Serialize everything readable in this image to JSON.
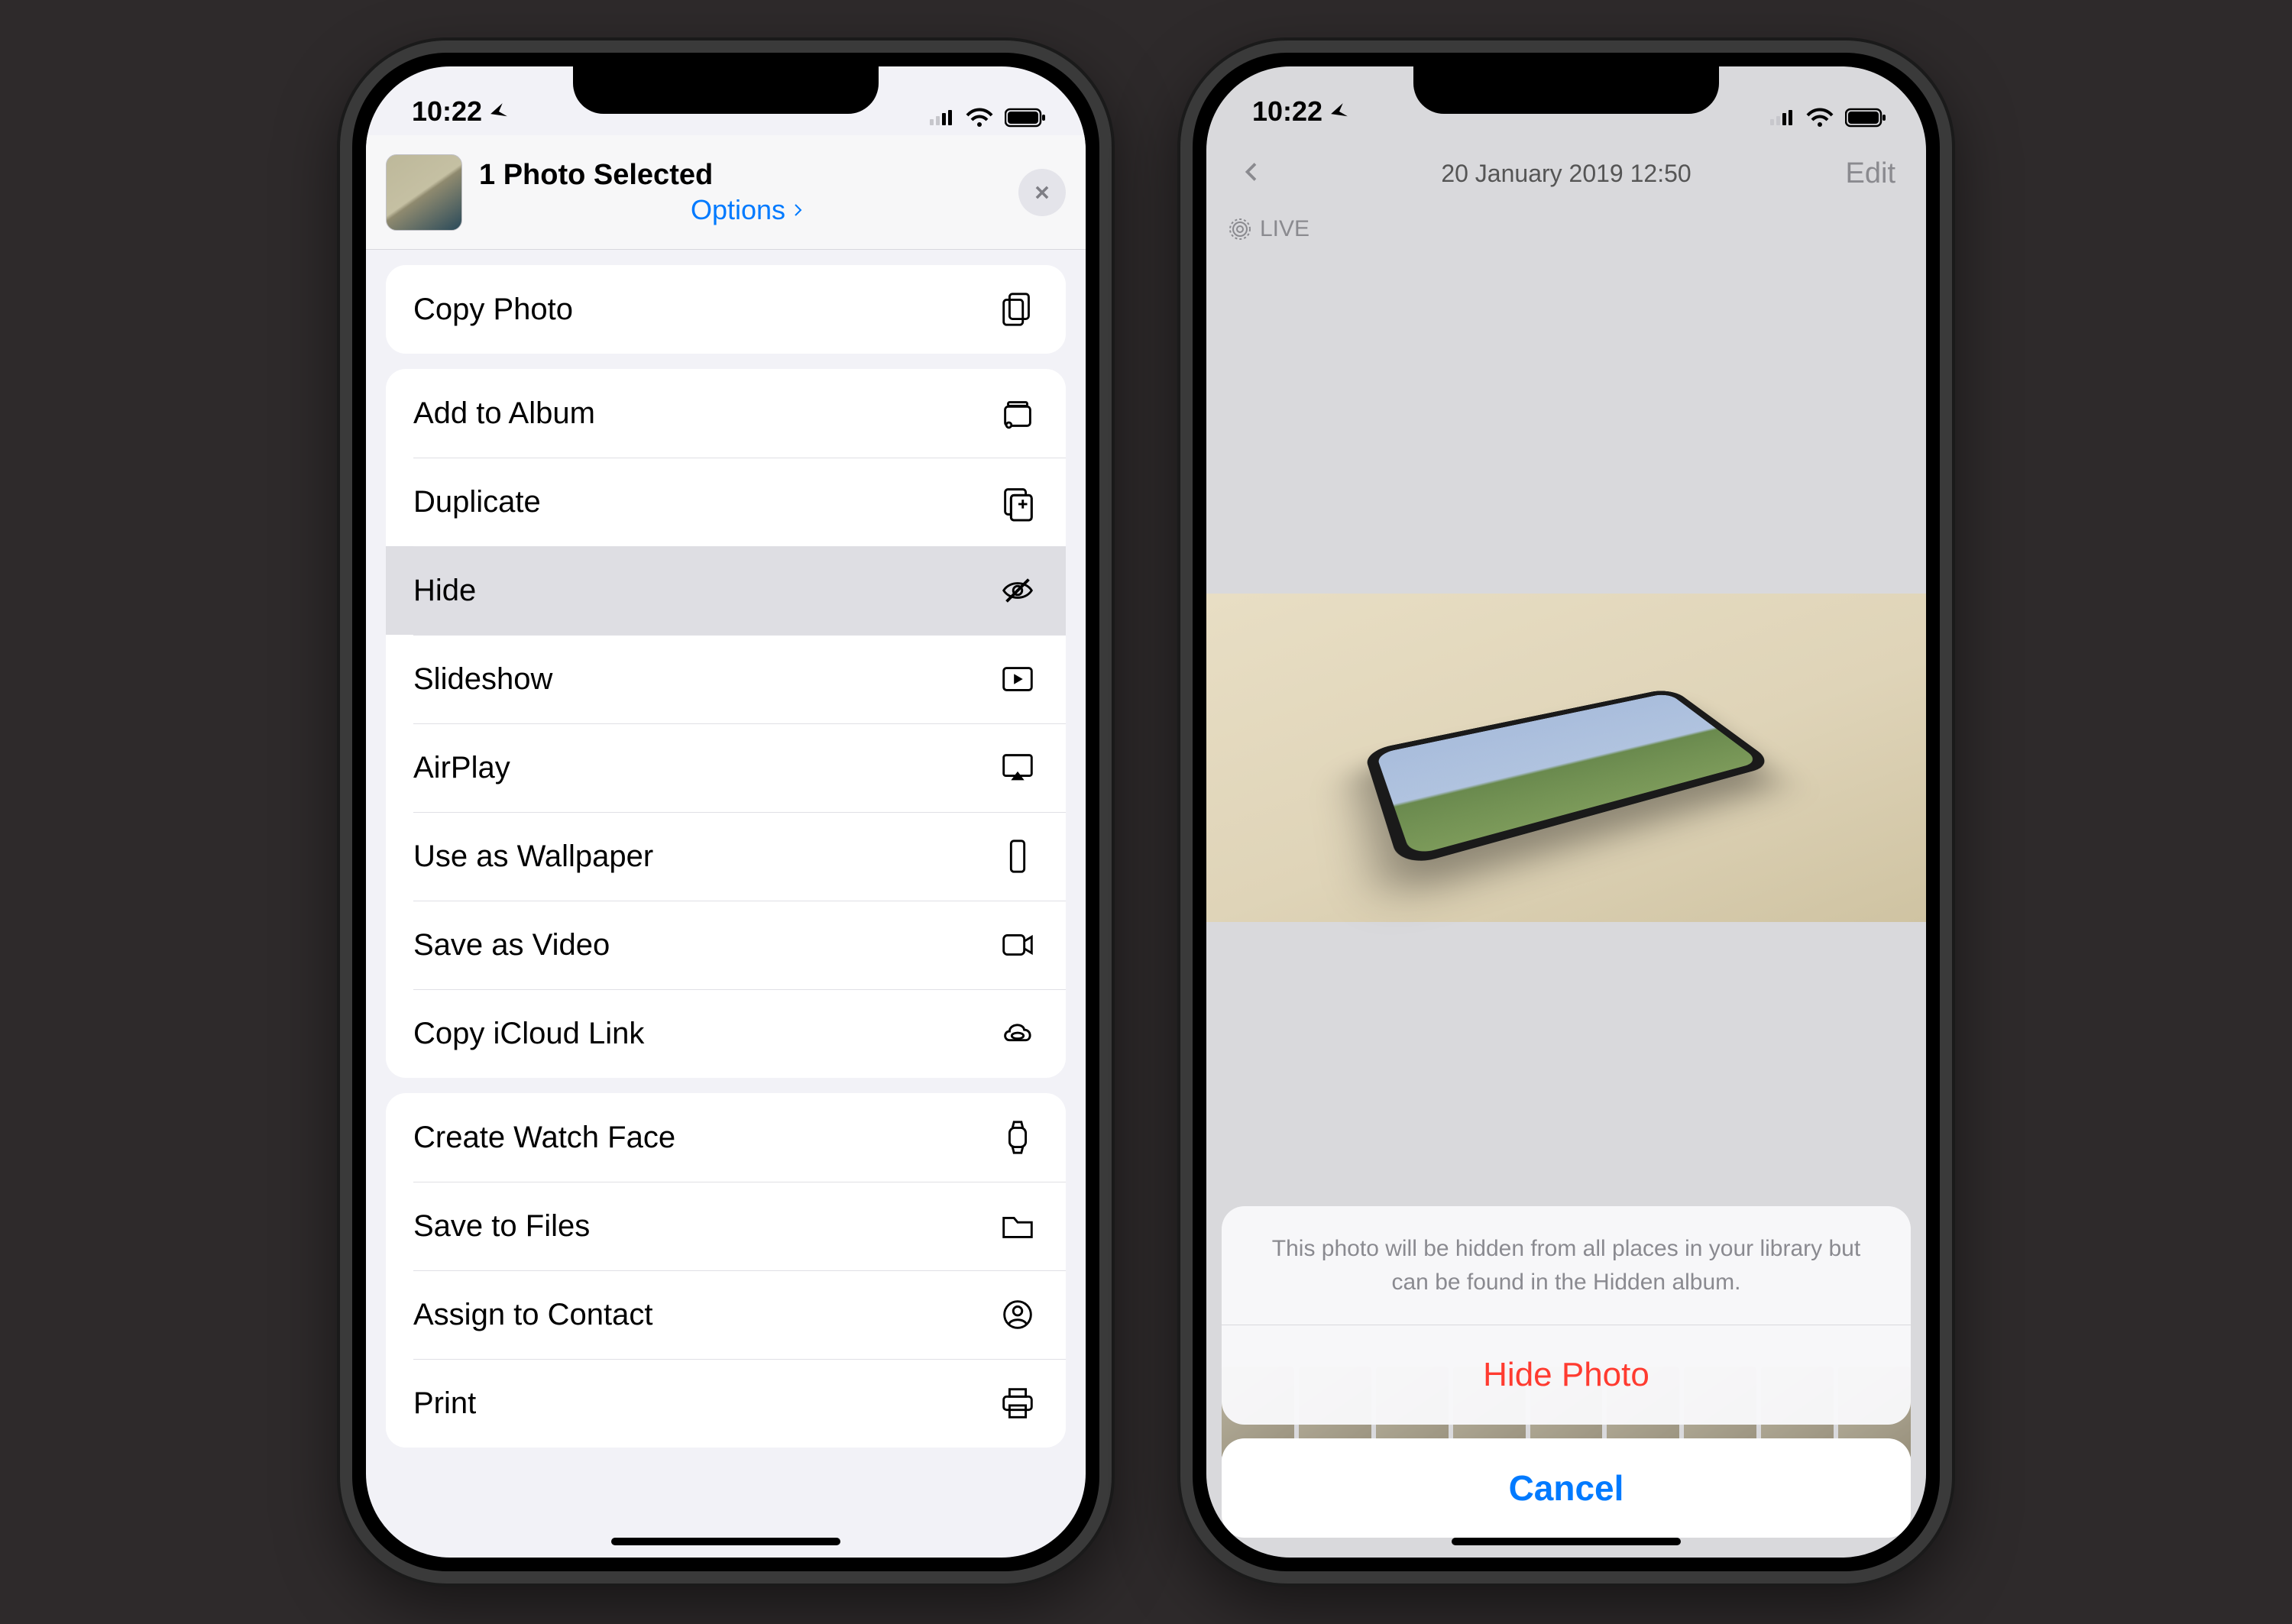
{
  "status": {
    "time": "10:22"
  },
  "left": {
    "header_title": "1 Photo Selected",
    "options_label": "Options",
    "groups": [
      [
        {
          "label": "Copy Photo",
          "icon": "copy"
        }
      ],
      [
        {
          "label": "Add to Album",
          "icon": "album"
        },
        {
          "label": "Duplicate",
          "icon": "duplicate"
        },
        {
          "label": "Hide",
          "icon": "hide",
          "highlight": true
        },
        {
          "label": "Slideshow",
          "icon": "play"
        },
        {
          "label": "AirPlay",
          "icon": "airplay"
        },
        {
          "label": "Use as Wallpaper",
          "icon": "wallpaper"
        },
        {
          "label": "Save as Video",
          "icon": "video"
        },
        {
          "label": "Copy iCloud Link",
          "icon": "cloudlink"
        }
      ],
      [
        {
          "label": "Create Watch Face",
          "icon": "watch"
        },
        {
          "label": "Save to Files",
          "icon": "folder"
        },
        {
          "label": "Assign to Contact",
          "icon": "contact"
        },
        {
          "label": "Print",
          "icon": "print"
        }
      ]
    ]
  },
  "right": {
    "title": "20 January 2019  12:50",
    "edit_label": "Edit",
    "live_label": "LIVE",
    "sheet_message": "This photo will be hidden from all places in your library but can be found in the Hidden album.",
    "destructive_label": "Hide Photo",
    "cancel_label": "Cancel"
  }
}
